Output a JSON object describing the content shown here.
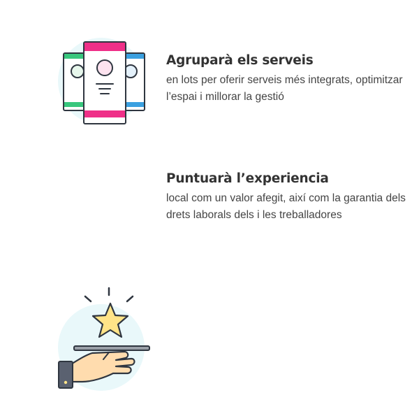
{
  "features": [
    {
      "icon": "service-cards-icon",
      "title": "Agruparà els serveis",
      "description": "en lots per oferir serveis més integrats, optimitzar l’espai i millorar la gestió"
    },
    {
      "icon": "hand-star-icon",
      "title": "Puntuarà l’experiencia",
      "description": "local com un valor afegit, així com la garantia dels drets laborals dels i les treballadores"
    }
  ],
  "colors": {
    "circle_bg": "#e9f8fa",
    "outline": "#2f3640",
    "pink": "#ef2f88",
    "green": "#38c77d",
    "blue": "#3aa0e0",
    "star": "#ffe488",
    "skin": "#ffdcae",
    "sleeve": "#5a6170"
  }
}
